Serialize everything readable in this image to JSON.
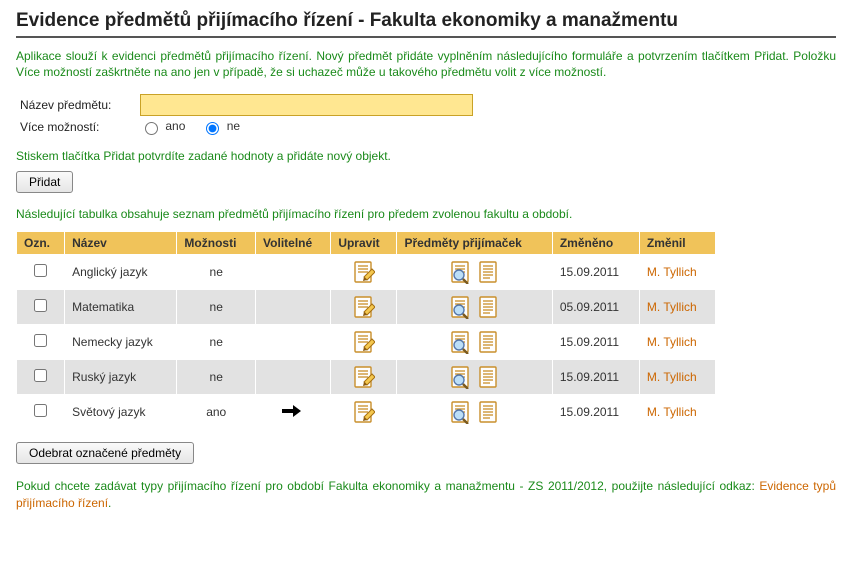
{
  "title": "Evidence předmětů přijímacího řízení - Fakulta ekonomiky a manažmentu",
  "intro": "Aplikace slouží k evidenci předmětů přijímacího řízení. Nový předmět přidáte vyplněním následujícího formuláře a potvrzením tlačítkem Přidat. Položku Více možností zaškrtněte na ano jen v případě, že si uchazeč může u takového předmětu volit z více možností.",
  "form": {
    "name_label": "Název předmětu:",
    "name_value": "",
    "more_label": "Více možností:",
    "radio_yes": "ano",
    "radio_no": "ne",
    "selected_radio": "ne",
    "hint": "Stiskem tlačítka Přidat potvrdíte zadané hodnoty a přidáte nový objekt.",
    "add_label": "Přidat"
  },
  "table_intro": "Následující tabulka obsahuje seznam předmětů přijímacího řízení pro předem zvolenou fakultu a období.",
  "table": {
    "headers": {
      "ozn": "Ozn.",
      "nazev": "Název",
      "moznosti": "Možnosti",
      "volitelne": "Volitelné",
      "upravit": "Upravit",
      "predmety": "Předměty přijímaček",
      "zmeneno": "Změněno",
      "zmenil": "Změnil"
    },
    "rows": [
      {
        "nazev": "Anglický jazyk",
        "moznosti": "ne",
        "volitelne": false,
        "zmeneno": "15.09.2011",
        "zmenil": "M. Tyllich"
      },
      {
        "nazev": "Matematika",
        "moznosti": "ne",
        "volitelne": false,
        "zmeneno": "05.09.2011",
        "zmenil": "M. Tyllich"
      },
      {
        "nazev": "Nemecky jazyk",
        "moznosti": "ne",
        "volitelne": false,
        "zmeneno": "15.09.2011",
        "zmenil": "M. Tyllich"
      },
      {
        "nazev": "Ruský jazyk",
        "moznosti": "ne",
        "volitelne": false,
        "zmeneno": "15.09.2011",
        "zmenil": "M. Tyllich"
      },
      {
        "nazev": "Světový jazyk",
        "moznosti": "ano",
        "volitelne": true,
        "zmeneno": "15.09.2011",
        "zmenil": "M. Tyllich"
      }
    ]
  },
  "remove_label": "Odebrat označené předměty",
  "footer": {
    "text_before": "Pokud chcete zadávat typy přijímacího řízení pro období Fakulta ekonomiky a manažmentu - ZS 2011/2012, použijte následující odkaz: ",
    "link_text": "Evidence typů přijímacího řízení",
    "text_after": "."
  }
}
